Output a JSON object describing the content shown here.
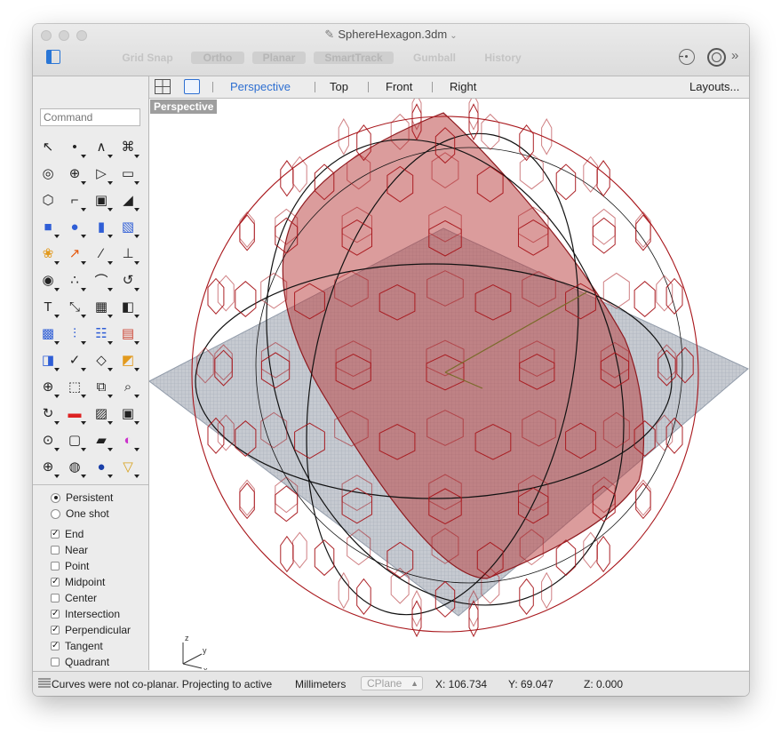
{
  "window": {
    "title": "SphereHexagon.3dm",
    "title_chevron": "⌄"
  },
  "toolbar": {
    "modes": [
      "Grid Snap",
      "Ortho",
      "Planar",
      "SmartTrack",
      "Gumball",
      "History"
    ],
    "more": "»"
  },
  "command": {
    "placeholder": "Command"
  },
  "viewport_tabs": [
    "Perspective",
    "Top",
    "Front",
    "Right"
  ],
  "layouts_label": "Layouts...",
  "viewport": {
    "label": "Perspective",
    "axis": {
      "z": "z",
      "y": "y",
      "x": "x"
    }
  },
  "osnap": {
    "mode_options": [
      {
        "label": "Persistent",
        "selected": true
      },
      {
        "label": "One shot",
        "selected": false
      }
    ],
    "snaps": [
      {
        "label": "End",
        "checked": true
      },
      {
        "label": "Near",
        "checked": false
      },
      {
        "label": "Point",
        "checked": false
      },
      {
        "label": "Midpoint",
        "checked": true
      },
      {
        "label": "Center",
        "checked": false
      },
      {
        "label": "Intersection",
        "checked": true
      },
      {
        "label": "Perpendicular",
        "checked": true
      },
      {
        "label": "Tangent",
        "checked": true
      },
      {
        "label": "Quadrant",
        "checked": false
      }
    ]
  },
  "status": {
    "message": "Curves were not co-planar. Projecting to active",
    "units": "Millimeters",
    "cplane": "CPlane",
    "x": "X: 106.734",
    "y": "Y: 69.047",
    "z": "Z: 0.000"
  },
  "colors": {
    "accent": "#2e6fd1",
    "surface_red": "#b83a3a",
    "wire_red": "#a8161b",
    "grid_gray": "#8d97a6"
  },
  "tool_icons": [
    "select-arrow-icon",
    "point-icon",
    "polyline-icon",
    "curve-icon",
    "circle-icon",
    "ellipse-icon",
    "arc-icon",
    "rectangle-icon",
    "polygon-icon",
    "fillet-curve-icon",
    "surface-from-points-icon",
    "sweep-icon",
    "box-icon",
    "sphere-icon",
    "cylinder-icon",
    "mesh-plane-icon",
    "explode-icon",
    "boolean-icon",
    "split-icon",
    "trim-icon",
    "solid-tools-icon",
    "group-icon",
    "blend-curve-icon",
    "offset-curve-icon",
    "text-icon",
    "transform-icon",
    "array-icon",
    "mirror-icon",
    "block-icon",
    "dimension-icon",
    "grid-array-icon",
    "layer-icon",
    "project-icon",
    "check-icon",
    "analyze-icon",
    "render-icon",
    "zoom-icon",
    "zoom-window-icon",
    "zoom-extents-icon",
    "zoom-selected-icon",
    "rotate-view-icon",
    "car-icon",
    "named-view-icon",
    "properties-icon",
    "light-icon",
    "lock-icon",
    "layer-state-icon",
    "color-wheel-icon",
    "wireframe-display-icon",
    "ghosted-display-icon",
    "rendered-display-icon",
    "material-icon"
  ]
}
